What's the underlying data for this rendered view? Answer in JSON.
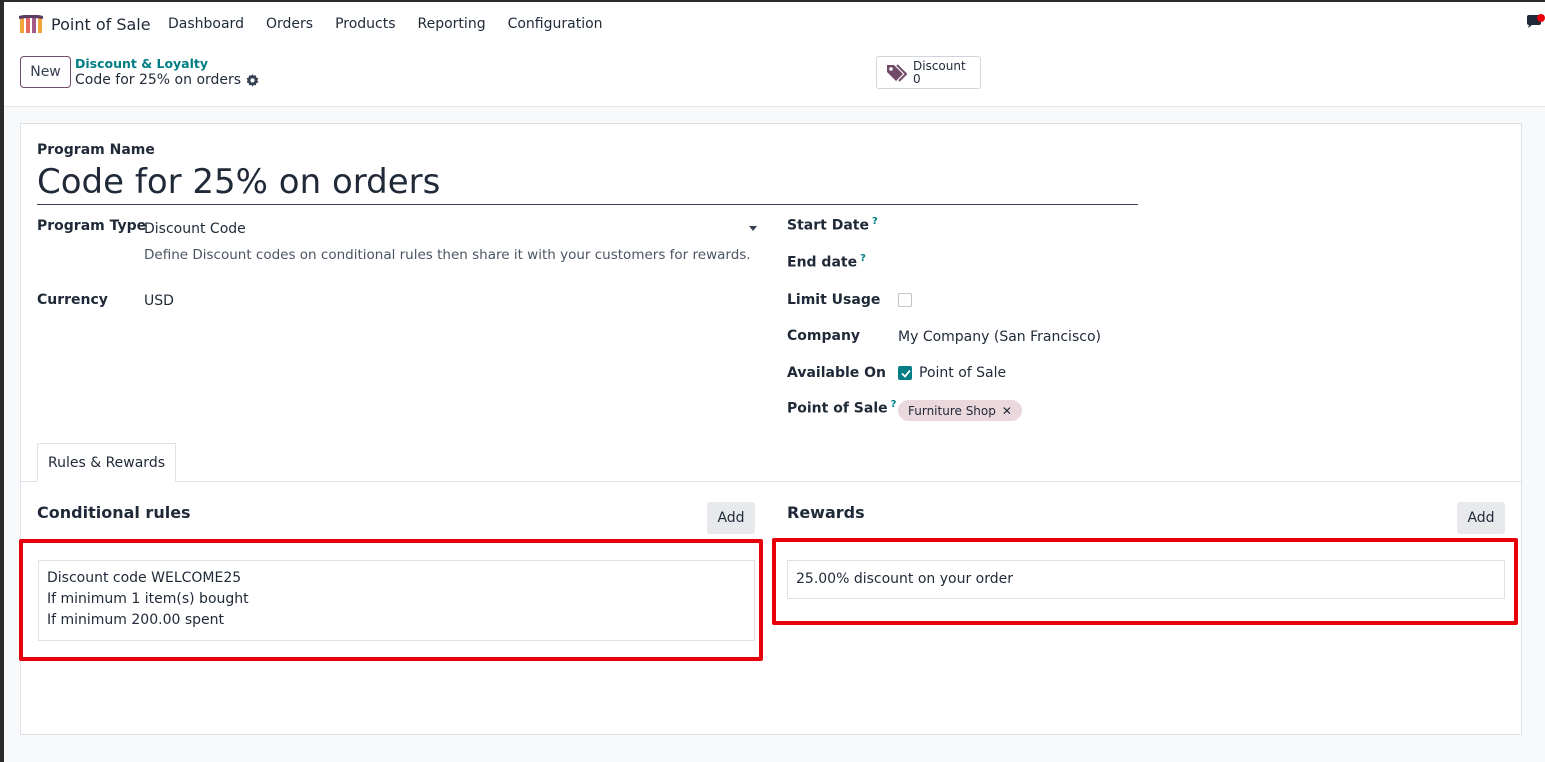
{
  "navbar": {
    "app_name": "Point of Sale",
    "menu": [
      "Dashboard",
      "Orders",
      "Products",
      "Reporting",
      "Configuration"
    ]
  },
  "control_panel": {
    "new_label": "New",
    "breadcrumb_parent": "Discount & Loyalty",
    "breadcrumb_current": "Code for 25% on orders",
    "smart_button": {
      "label": "Discount",
      "value": "0"
    }
  },
  "form": {
    "program_name_label": "Program Name",
    "program_name": "Code for 25% on orders",
    "program_type_label": "Program Type",
    "program_type": "Discount Code",
    "program_type_help": "Define Discount codes on conditional rules then share it with your customers for rewards.",
    "currency_label": "Currency",
    "currency": "USD",
    "start_date_label": "Start Date",
    "end_date_label": "End date",
    "limit_usage_label": "Limit Usage",
    "company_label": "Company",
    "company": "My Company (San Francisco)",
    "available_on_label": "Available On",
    "available_on_option": "Point of Sale",
    "point_of_sale_label": "Point of Sale",
    "point_of_sale_tag": "Furniture Shop",
    "help_mark": "?"
  },
  "tabs": [
    "Rules & Rewards"
  ],
  "rules": {
    "title": "Conditional rules",
    "add_label": "Add",
    "lines": [
      "Discount code WELCOME25",
      "If minimum 1 item(s) bought",
      "If minimum 200.00 spent"
    ]
  },
  "rewards": {
    "title": "Rewards",
    "add_label": "Add",
    "lines": [
      "25.00% discount on your order"
    ]
  },
  "colors": {
    "brand": "#714b67",
    "accent": "#017e84",
    "highlight": "#e8000b"
  }
}
